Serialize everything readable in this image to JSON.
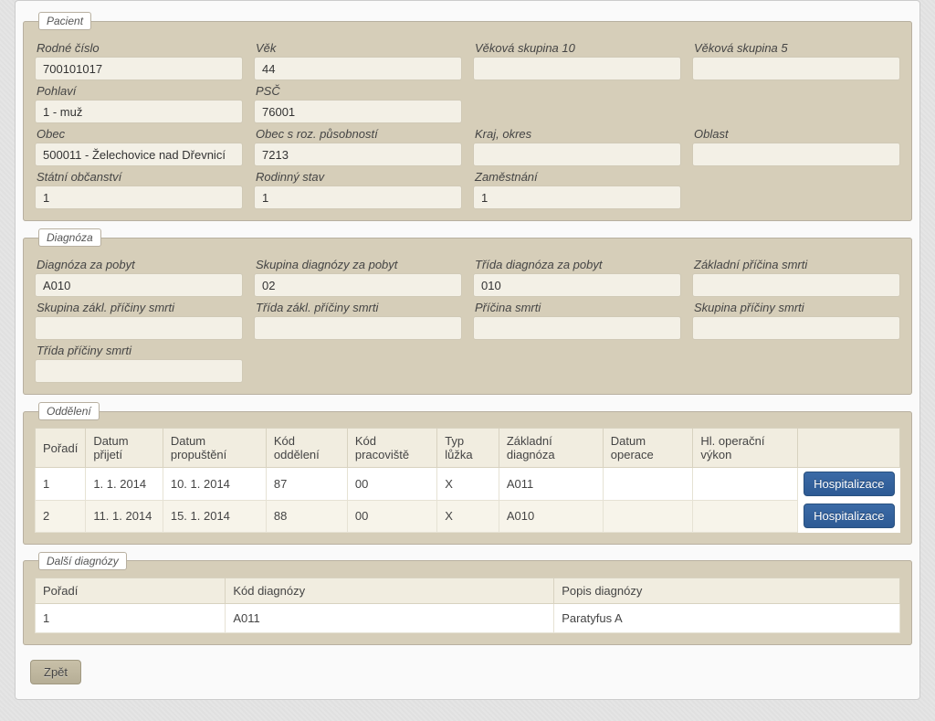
{
  "pacient": {
    "legend": "Pacient",
    "rodne_cislo": {
      "label": "Rodné číslo",
      "value": "700101017"
    },
    "vek": {
      "label": "Věk",
      "value": "44"
    },
    "vek_skupina_10": {
      "label": "Věková skupina 10",
      "value": ""
    },
    "vek_skupina_5": {
      "label": "Věková skupina 5",
      "value": ""
    },
    "pohlavi": {
      "label": "Pohlaví",
      "value": "1 - muž"
    },
    "psc": {
      "label": "PSČ",
      "value": "76001"
    },
    "obec": {
      "label": "Obec",
      "value": "500011 - Želechovice nad Dřevnicí"
    },
    "obec_roz": {
      "label": "Obec s roz. působností",
      "value": "7213"
    },
    "kraj_okres": {
      "label": "Kraj, okres",
      "value": ""
    },
    "oblast": {
      "label": "Oblast",
      "value": ""
    },
    "statni_obcanstvi": {
      "label": "Státní občanství",
      "value": "1"
    },
    "rodinny_stav": {
      "label": "Rodinný stav",
      "value": "1"
    },
    "zamestnani": {
      "label": "Zaměstnání",
      "value": "1"
    }
  },
  "diagnoza": {
    "legend": "Diagnóza",
    "diag_pobyt": {
      "label": "Diagnóza za pobyt",
      "value": "A010"
    },
    "skup_diag_pobyt": {
      "label": "Skupina diagnózy za pobyt",
      "value": "02"
    },
    "trida_diag_pobyt": {
      "label": "Třída diagnóza za pobyt",
      "value": "010"
    },
    "zakl_pricina_smrti": {
      "label": "Základní příčina smrti",
      "value": ""
    },
    "skup_zakl_pricina": {
      "label": "Skupina zákl. příčiny smrti",
      "value": ""
    },
    "trida_zakl_pricina": {
      "label": "Třída zákl. příčiny smrti",
      "value": ""
    },
    "pricina_smrti": {
      "label": "Příčina smrti",
      "value": ""
    },
    "skup_pricina_smrti": {
      "label": "Skupina příčiny smrti",
      "value": ""
    },
    "trida_pricina_smrti": {
      "label": "Třída příčiny smrti",
      "value": ""
    }
  },
  "oddeleni": {
    "legend": "Oddělení",
    "headers": {
      "poradi": "Pořadí",
      "datum_prijeti": "Datum přijetí",
      "datum_propusteni": "Datum propuštění",
      "kod_oddeleni": "Kód oddělení",
      "kod_pracoviste": "Kód pracoviště",
      "typ_luzka": "Typ lůžka",
      "zakladni_diagnoza": "Základní diagnóza",
      "datum_operace": "Datum operace",
      "hl_operacni_vykon": "Hl. operační výkon"
    },
    "rows": [
      {
        "poradi": "1",
        "datum_prijeti": "1. 1. 2014",
        "datum_propusteni": "10. 1. 2014",
        "kod_oddeleni": "87",
        "kod_pracoviste": "00",
        "typ_luzka": "X",
        "zakladni_diagnoza": "A011",
        "datum_operace": "",
        "hl_operacni_vykon": ""
      },
      {
        "poradi": "2",
        "datum_prijeti": "11. 1. 2014",
        "datum_propusteni": "15. 1. 2014",
        "kod_oddeleni": "88",
        "kod_pracoviste": "00",
        "typ_luzka": "X",
        "zakladni_diagnoza": "A010",
        "datum_operace": "",
        "hl_operacni_vykon": ""
      }
    ],
    "action_label": "Hospitalizace"
  },
  "dalsi_diagnozy": {
    "legend": "Další diagnózy",
    "headers": {
      "poradi": "Pořadí",
      "kod": "Kód diagnózy",
      "popis": "Popis diagnózy"
    },
    "rows": [
      {
        "poradi": "1",
        "kod": "A011",
        "popis": "Paratyfus A"
      }
    ]
  },
  "back_button": "Zpět"
}
